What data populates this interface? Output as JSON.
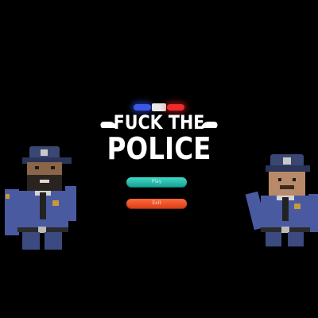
{
  "logo": {
    "line1": "FUCK THE",
    "line2": "POLICE"
  },
  "menu": {
    "play_label": "Play",
    "exit_label": "Exit"
  },
  "colors": {
    "background": "#000000",
    "play_button": "#1fb8a8",
    "exit_button": "#e8502a",
    "siren_blue": "#3a58e8",
    "siren_red": "#ee2a2a",
    "uniform": "#4a5aa0",
    "cap": "#3c4a7a"
  },
  "icons": {
    "siren": "police-siren-icon",
    "left_character": "police-officer-left",
    "right_character": "police-officer-right"
  }
}
